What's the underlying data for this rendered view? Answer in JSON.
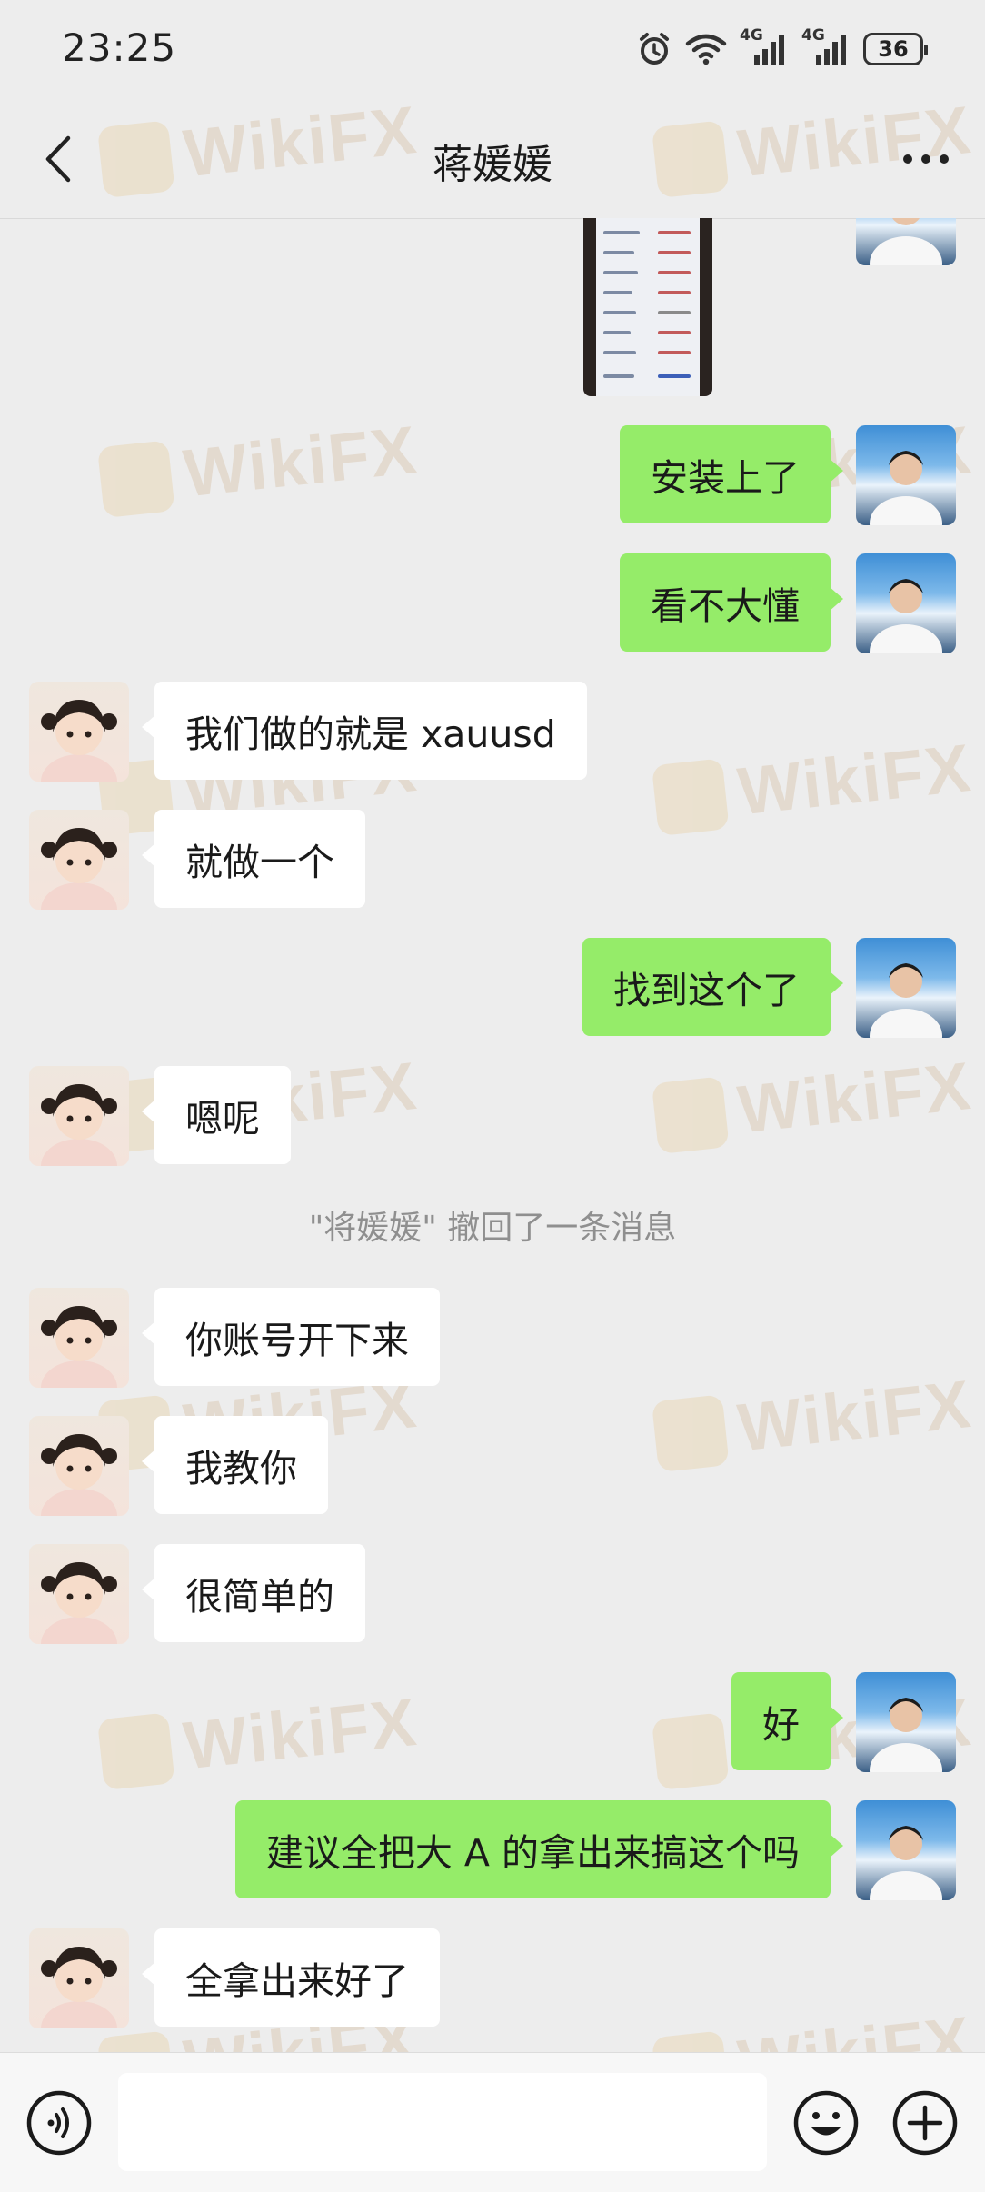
{
  "status_bar": {
    "time": "23:25",
    "network_1": "4G",
    "network_2": "4G",
    "battery": "36",
    "icons": [
      "alarm-icon",
      "wifi-icon",
      "signal-icon",
      "signal-icon",
      "battery-icon"
    ]
  },
  "header": {
    "title": "蒋媛媛",
    "back_icon": "chevron-left-icon",
    "more_icon": "more-dots-icon"
  },
  "watermark": {
    "text": "WikiFX"
  },
  "messages": [
    {
      "side": "right",
      "type": "image",
      "content": "screenshot"
    },
    {
      "side": "right",
      "type": "text",
      "text": "安装上了"
    },
    {
      "side": "right",
      "type": "text",
      "text": "看不大懂"
    },
    {
      "side": "left",
      "type": "text",
      "text": "我们做的就是 xauusd"
    },
    {
      "side": "left",
      "type": "text",
      "text": "就做一个"
    },
    {
      "side": "right",
      "type": "text",
      "text": "找到这个了"
    },
    {
      "side": "left",
      "type": "text",
      "text": "嗯呢"
    },
    {
      "side": "system",
      "type": "notice",
      "text": "\"将媛媛\" 撤回了一条消息"
    },
    {
      "side": "left",
      "type": "text",
      "text": "你账号开下来"
    },
    {
      "side": "left",
      "type": "text",
      "text": "我教你"
    },
    {
      "side": "left",
      "type": "text",
      "text": "很简单的"
    },
    {
      "side": "right",
      "type": "text",
      "text": "好"
    },
    {
      "side": "right",
      "type": "text",
      "text": "建议全把大 A 的拿出来搞这个吗"
    },
    {
      "side": "left",
      "type": "text",
      "text": "全拿出来好了"
    }
  ],
  "input_bar": {
    "voice_icon": "voice-icon",
    "emoji_icon": "emoji-icon",
    "plus_icon": "plus-icon",
    "value": ""
  },
  "colors": {
    "background": "#ededed",
    "bubble_right": "#95ec69",
    "bubble_left": "#ffffff",
    "notice_text": "#8f8f8f"
  }
}
